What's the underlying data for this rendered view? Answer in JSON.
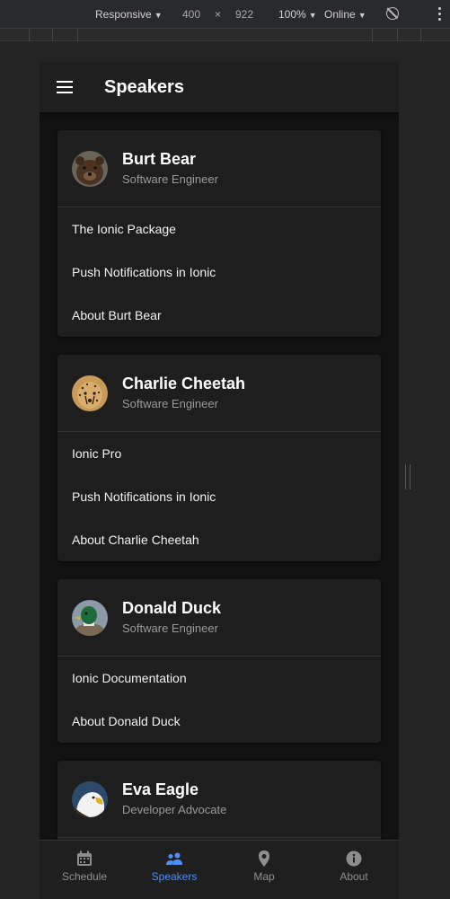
{
  "devtools": {
    "mode": "Responsive",
    "width": "400",
    "times": "×",
    "height": "922",
    "zoom": "100%",
    "network": "Online"
  },
  "header": {
    "title": "Speakers"
  },
  "speakers": [
    {
      "name": "Burt Bear",
      "title": "Software Engineer",
      "items": [
        "The Ionic Package",
        "Push Notifications in Ionic",
        "About Burt Bear"
      ]
    },
    {
      "name": "Charlie Cheetah",
      "title": "Software Engineer",
      "items": [
        "Ionic Pro",
        "Push Notifications in Ionic",
        "About Charlie Cheetah"
      ]
    },
    {
      "name": "Donald Duck",
      "title": "Software Engineer",
      "items": [
        "Ionic Documentation",
        "About Donald Duck"
      ]
    },
    {
      "name": "Eva Eagle",
      "title": "Developer Advocate",
      "items": []
    }
  ],
  "tabs": [
    {
      "label": "Schedule",
      "icon": "calendar-icon",
      "active": false
    },
    {
      "label": "Speakers",
      "icon": "people-icon",
      "active": true
    },
    {
      "label": "Map",
      "icon": "map-pin-icon",
      "active": false
    },
    {
      "label": "About",
      "icon": "info-icon",
      "active": false
    }
  ],
  "colors": {
    "accent": "#4d8dff",
    "background": "#121212",
    "card": "#1e1e1e"
  }
}
